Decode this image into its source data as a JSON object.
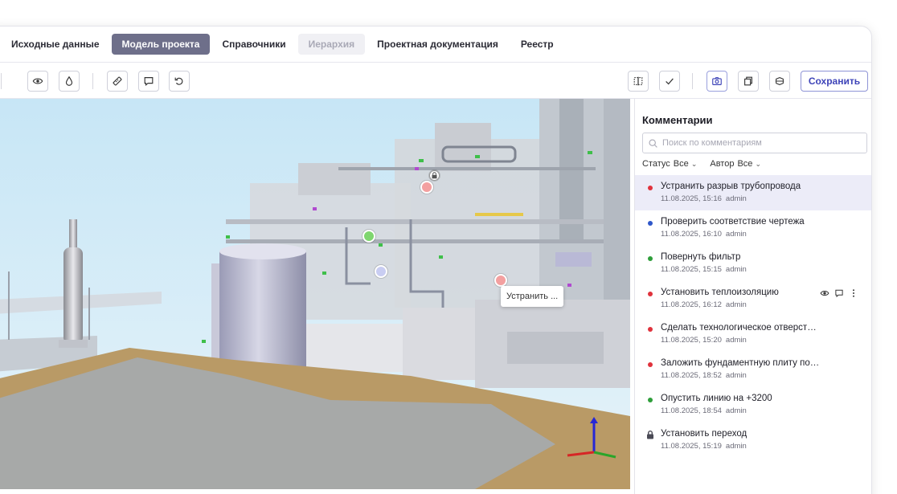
{
  "nav": {
    "tabs": [
      {
        "label": "Исходные данные",
        "state": "normal"
      },
      {
        "label": "Модель проекта",
        "state": "active"
      },
      {
        "label": "Справочники",
        "state": "normal"
      },
      {
        "label": "Иерархия",
        "state": "disabled"
      },
      {
        "label": "Проектная документация",
        "state": "normal"
      },
      {
        "label": "Реестр",
        "state": "normal"
      }
    ]
  },
  "toolbar": {
    "left_icons": [
      "eye-icon",
      "drop-icon",
      "ruler-icon",
      "comment-icon",
      "undo-icon"
    ],
    "right_icons": [
      "split-view-icon",
      "check-icon",
      "camera-icon",
      "copy-icon",
      "section-box-icon"
    ],
    "save_label": "Сохранить"
  },
  "viewport": {
    "tooltip": "Устранить ...",
    "marker_colors": {
      "red": "#f3a0a0",
      "green": "#7fd66f",
      "blue": "#c9cdf2"
    }
  },
  "comments": {
    "title": "Комментарии",
    "search_placeholder": "Поиск по комментариям",
    "filters": {
      "status_label": "Статус",
      "status_value": "Все",
      "author_label": "Автор",
      "author_value": "Все"
    },
    "status_colors": {
      "red": "#e0323c",
      "blue": "#2f57c9",
      "green": "#2e9e3a"
    },
    "items": [
      {
        "title": "Устранить разрыв трубопровода",
        "date": "11.08.2025, 15:16",
        "author": "admin",
        "status": "red",
        "selected": true
      },
      {
        "title": "Проверить соответствие чертежа",
        "date": "11.08.2025, 16:10",
        "author": "admin",
        "status": "blue"
      },
      {
        "title": "Повернуть фильтр",
        "date": "11.08.2025, 15:15",
        "author": "admin",
        "status": "green"
      },
      {
        "title": "Установить теплоизоляцию",
        "date": "11.08.2025, 16:12",
        "author": "admin",
        "status": "red",
        "hover": true
      },
      {
        "title": "Сделать технологическое отверст…",
        "date": "11.08.2025, 15:20",
        "author": "admin",
        "status": "red"
      },
      {
        "title": "Заложить фундаментную плиту по…",
        "date": "11.08.2025, 18:52",
        "author": "admin",
        "status": "red"
      },
      {
        "title": "Опустить линию на +3200",
        "date": "11.08.2025, 18:54",
        "author": "admin",
        "status": "green"
      },
      {
        "title": "Установить переход",
        "date": "11.08.2025, 15:19",
        "author": "admin",
        "status": "locked"
      }
    ]
  }
}
